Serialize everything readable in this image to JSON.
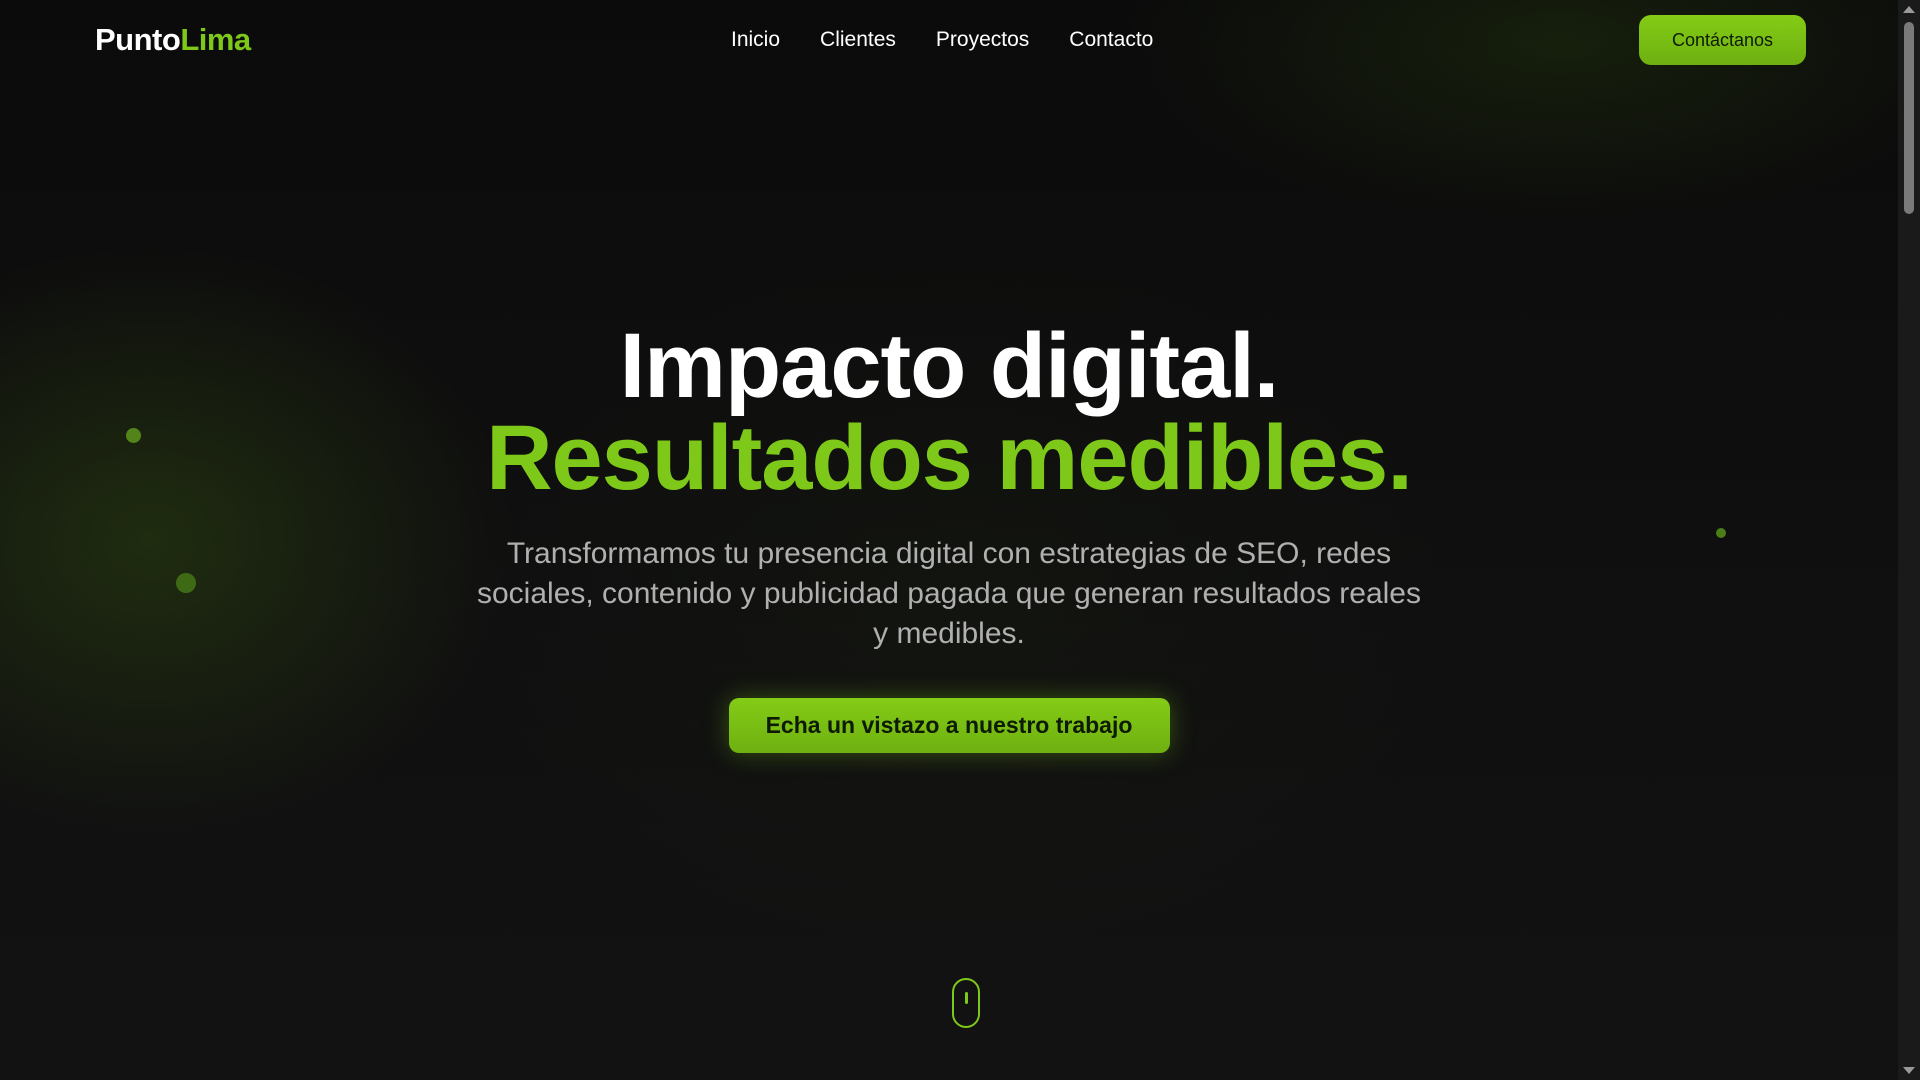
{
  "header": {
    "logo_part1": "Punto",
    "logo_part2": "Lima",
    "nav": [
      "Inicio",
      "Clientes",
      "Proyectos",
      "Contacto"
    ],
    "cta_label": "Contáctanos"
  },
  "hero": {
    "title_line1": "Impacto digital.",
    "title_line2": "Resultados medibles.",
    "subtitle": "Transformamos tu presencia digital con estrategias de SEO, redes sociales, contenido y publicidad pagada que generan resultados reales y medibles.",
    "cta_label": "Echa un vistazo a nuestro trabajo"
  },
  "icons": {
    "scroll": "mouse-scroll-icon"
  },
  "colors": {
    "accent": "#7ec81a",
    "background": "#0c0c0c",
    "text": "#ffffff",
    "muted": "#b0b0b0"
  }
}
